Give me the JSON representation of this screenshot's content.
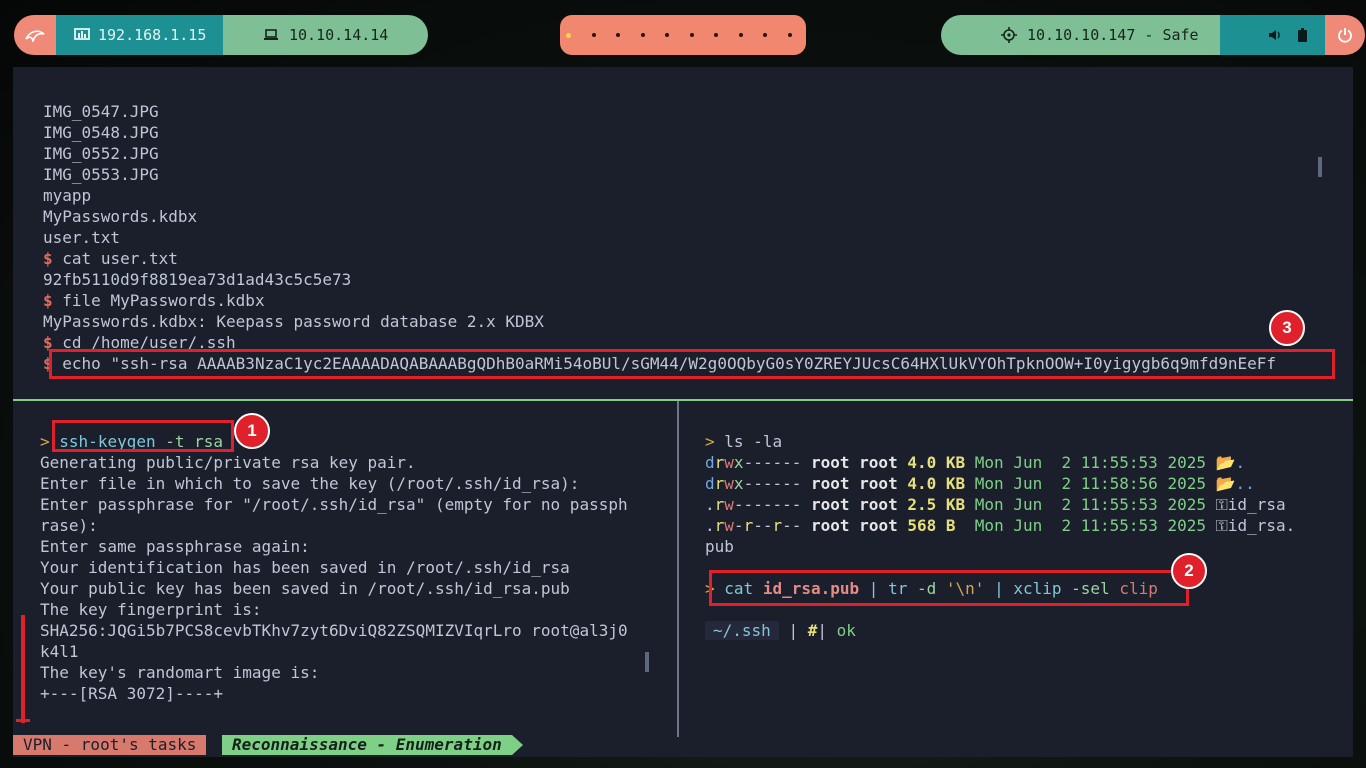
{
  "topbar": {
    "local_ip": "192.168.1.15",
    "vpn_ip": "10.10.14.14",
    "target": "10.10.10.147 - Safe"
  },
  "top_pane": {
    "lines": [
      "IMG_0547.JPG",
      "IMG_0548.JPG",
      "IMG_0552.JPG",
      "IMG_0553.JPG",
      "myapp",
      "MyPasswords.kdbx",
      "user.txt"
    ],
    "cmd_cat": "cat user.txt",
    "hash": "92fb5110d9f8819ea73d1ad43c5c5e73",
    "cmd_file": "file MyPasswords.kdbx",
    "file_out": "MyPasswords.kdbx: Keepass password database 2.x KDBX",
    "cmd_cd": "cd /home/user/.ssh",
    "cmd_echo": "echo \"ssh-rsa AAAAB3NzaC1yc2EAAAADAQABAAABgQDhB0aRMi54oBUl/sGM44/W2g0OQbyG0sY0ZREYJUcsC64HXlUkVYOhTpknOOW+I0yigygb6q9mfd9nEeFf",
    "prompt": "$"
  },
  "left_pane": {
    "arrow": ">",
    "cmd": "ssh-keygen",
    "args": "-t rsa",
    "lines": [
      "Generating public/private rsa key pair.",
      "Enter file in which to save the key (/root/.ssh/id_rsa):",
      "Enter passphrase for \"/root/.ssh/id_rsa\" (empty for no passph",
      "rase):",
      "Enter same passphrase again:",
      "Your identification has been saved in /root/.ssh/id_rsa",
      "Your public key has been saved in /root/.ssh/id_rsa.pub",
      "The key fingerprint is:",
      "SHA256:JQGi5b7PCS8cevbTKhv7zyt6DviQ82ZSQMIZVIqrLro root@al3j0",
      "k4l1",
      "The key's randomart image is:",
      "+---[RSA 3072]----+"
    ]
  },
  "right_pane": {
    "arrow": ">",
    "ls_cmd": "ls -la",
    "rows": [
      {
        "perm": "drwx------",
        "owner": "root root",
        "size": "4.0 KB",
        "date": "Mon Jun  2 11:55:53 2025",
        "icon": "folder-open-icon",
        "name": "."
      },
      {
        "perm": "drwx------",
        "owner": "root root",
        "size": "4.0 KB",
        "date": "Mon Jun  2 11:58:56 2025",
        "icon": "folder-open-icon",
        "name": ".."
      },
      {
        "perm": ".rw-------",
        "owner": "root root",
        "size": "2.5 KB",
        "date": "Mon Jun  2 11:55:53 2025",
        "icon": "key-icon",
        "name": "id_rsa"
      },
      {
        "perm": ".rw-r--r--",
        "owner": "root root",
        "size": "568 B ",
        "date": "Mon Jun  2 11:55:53 2025",
        "icon": "key-icon",
        "name": "id_rsa."
      }
    ],
    "wrap": "pub",
    "cmd2": {
      "cat": "cat",
      "file": "id_rsa.pub",
      "pipe1": "|",
      "tr": "tr",
      "tr_args": "-d",
      "tr_str": "'\\n'",
      "pipe2": "|",
      "xclip": "xclip",
      "xclip_flag": "-sel",
      "xclip_arg": "clip"
    },
    "status": {
      "path": "~/.ssh",
      "sep1": "|",
      "hash": "#",
      "sep2": "|",
      "ok": "ok"
    }
  },
  "annotations": {
    "one": "1",
    "two": "2",
    "three": "3"
  },
  "statusbar": {
    "session": "VPN - root's tasks",
    "window": "Reconnaissance - Enumeration"
  },
  "colors": {
    "accent_red": "#e0202a",
    "prompt": "#e06c5c",
    "divider": "#7fd087"
  }
}
